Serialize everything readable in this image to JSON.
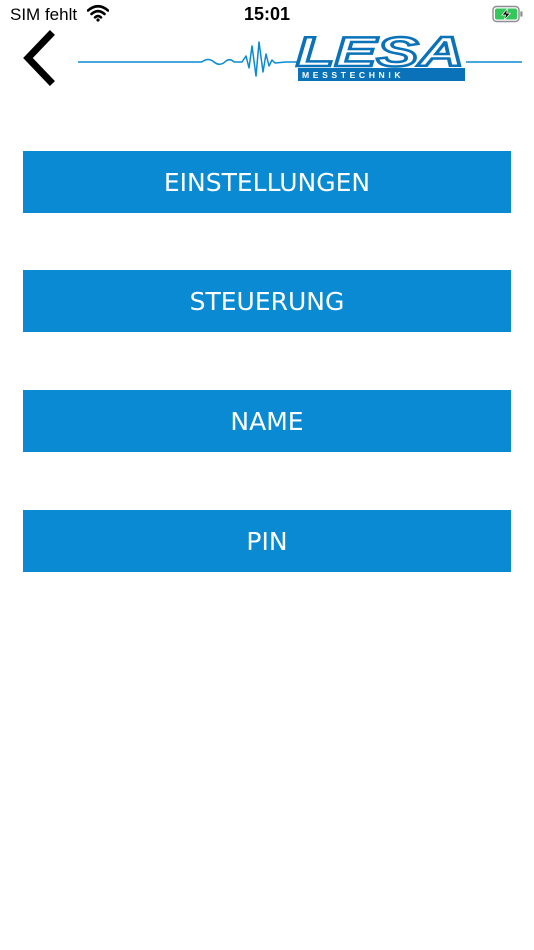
{
  "status_bar": {
    "carrier": "SIM fehlt",
    "time": "15:01",
    "icons": [
      "wifi-icon",
      "battery-charging-icon"
    ]
  },
  "header": {
    "back_icon": "chevron-left-icon",
    "logo": {
      "wordmark": "LESA",
      "subtitle": "MESSTECHNIK"
    }
  },
  "menu": {
    "items": [
      {
        "label": "EINSTELLUNGEN"
      },
      {
        "label": "STEUERUNG"
      },
      {
        "label": "NAME"
      },
      {
        "label": "PIN"
      }
    ]
  },
  "colors": {
    "accent": "#0a8ad3",
    "logo_blue": "#0a72b8",
    "battery_green": "#34c759"
  }
}
